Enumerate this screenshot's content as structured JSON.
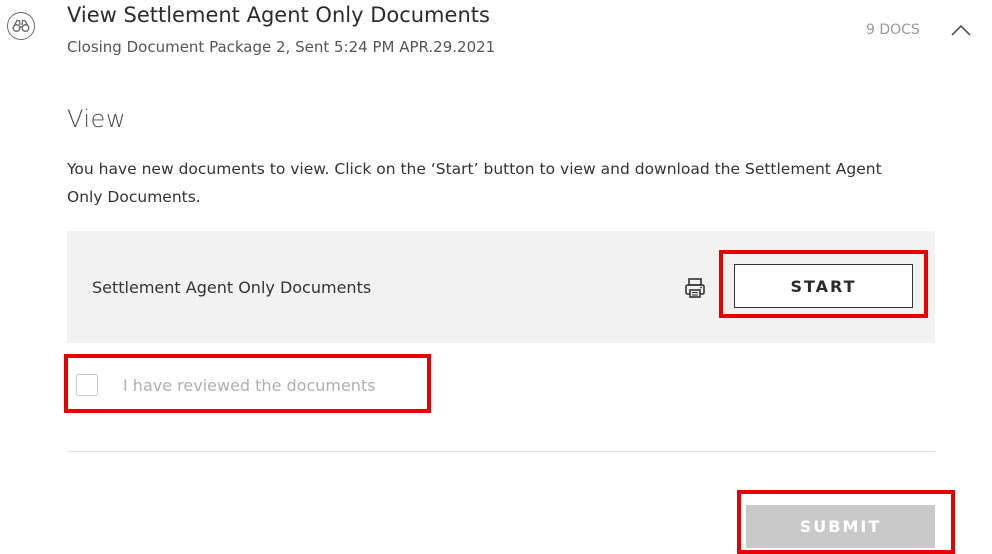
{
  "header": {
    "icon": "binoculars-icon",
    "title": "View Settlement Agent Only Documents",
    "subtitle": "Closing Document Package 2, Sent 5:24 PM APR.29.2021",
    "doc_count": "9 DOCS",
    "collapse_icon": "chevron-up-icon"
  },
  "section": {
    "heading": "View",
    "instructions": "You have new documents to view. Click on the ‘Start’ button to view and download the Settlement Agent Only Documents."
  },
  "document": {
    "name": "Settlement Agent Only Documents",
    "print_icon": "printer-icon",
    "start_label": "START"
  },
  "review": {
    "checkbox_label": "I have reviewed the documents",
    "checked": false
  },
  "actions": {
    "submit_label": "SUBMIT"
  },
  "colors": {
    "highlight": "#e60000",
    "panel_background": "#f2f2f2",
    "submit_disabled": "#c9c9c9"
  }
}
